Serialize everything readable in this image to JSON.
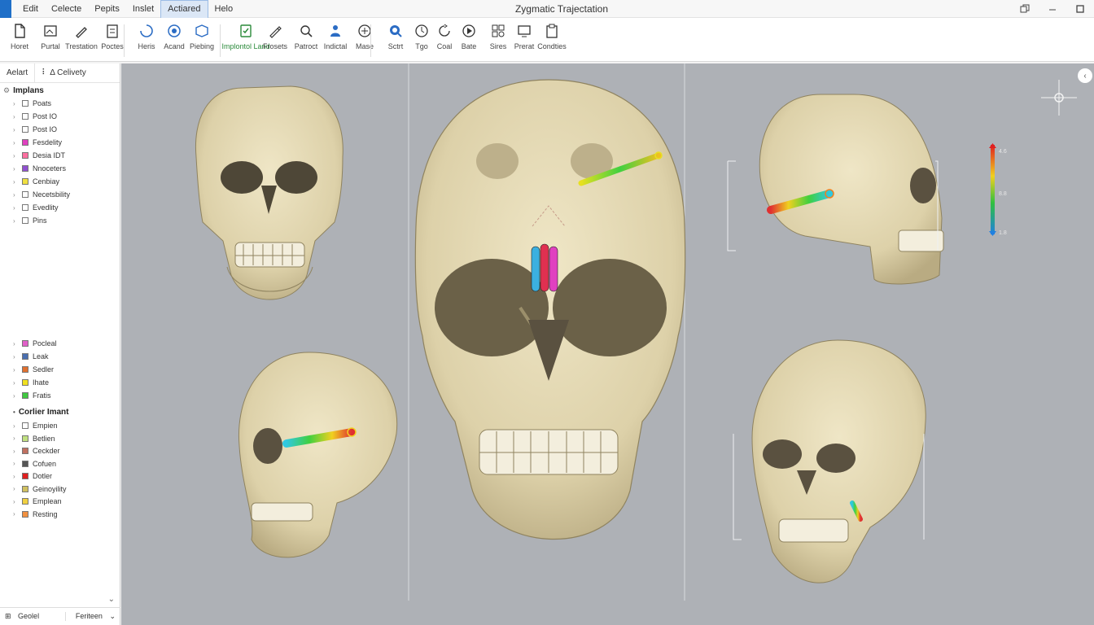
{
  "window": {
    "title": "Zygmatic Trajectation"
  },
  "menu": {
    "items": [
      "Edit",
      "Celecte",
      "Pepits",
      "Inslet",
      "Actiared",
      "Helo"
    ],
    "active_index": 4
  },
  "toolbar": {
    "tools": [
      {
        "label": "Horet",
        "icon": "file-icon"
      },
      {
        "label": "Purtal",
        "icon": "image-icon"
      },
      {
        "label": "Trestation",
        "icon": "pen-icon"
      },
      {
        "label": "Poctes",
        "icon": "document-icon"
      },
      {
        "label": "Heris",
        "icon": "circle-arc-icon"
      },
      {
        "label": "Acand",
        "icon": "target-icon"
      },
      {
        "label": "Piebing",
        "icon": "box-icon"
      },
      {
        "label": "Implontol Land",
        "icon": "implant-icon"
      },
      {
        "label": "Frosets",
        "icon": "pencil-icon"
      },
      {
        "label": "Patroct",
        "icon": "magnifier-icon"
      },
      {
        "label": "Indictal",
        "icon": "person-icon"
      },
      {
        "label": "Mase",
        "icon": "plus-circle-icon"
      },
      {
        "label": "Sctrt",
        "icon": "search-icon"
      },
      {
        "label": "Tgo",
        "icon": "clock-icon"
      },
      {
        "label": "Coal",
        "icon": "refresh-icon"
      },
      {
        "label": "Bate",
        "icon": "play-circle-icon"
      },
      {
        "label": "Sires",
        "icon": "gear-grid-icon"
      },
      {
        "label": "Prerat",
        "icon": "screen-icon"
      },
      {
        "label": "Condties",
        "icon": "clipboard-icon"
      }
    ]
  },
  "left_panel": {
    "tabs": [
      "Aelart",
      "Celivety"
    ],
    "root_label": "Implans",
    "tree_items": [
      {
        "label": "Poats",
        "swatch": "#ffffff"
      },
      {
        "label": "Post IO",
        "swatch": "#ffffff"
      },
      {
        "label": "Post IO",
        "swatch": "#ffffff"
      },
      {
        "label": "Fesdelity",
        "swatch": "#e040c0"
      },
      {
        "label": "Desia IDT",
        "swatch": "#ff6fa0"
      },
      {
        "label": "Nnoceters",
        "swatch": "#9050d0"
      },
      {
        "label": "Cenbiay",
        "swatch": "#f0e040"
      },
      {
        "label": "Necetsbility",
        "swatch": "#ffffff"
      },
      {
        "label": "Evedlity",
        "swatch": "#ffffff"
      },
      {
        "label": "Pins",
        "swatch": "#ffffff"
      }
    ],
    "material_items": [
      {
        "label": "Pocleal",
        "swatch": "#e060c8"
      },
      {
        "label": "Leak",
        "swatch": "#4a6fb0"
      },
      {
        "label": "Sedler",
        "swatch": "#e07030"
      },
      {
        "label": "Ihate",
        "swatch": "#f0e020"
      },
      {
        "label": "Fratis",
        "swatch": "#40c840"
      }
    ],
    "group_label": "Corlier Imant",
    "group_items": [
      {
        "label": "Empien",
        "swatch": "#ffffff"
      },
      {
        "label": "Betlien",
        "swatch": "#c0e080"
      },
      {
        "label": "Ceckder",
        "swatch": "#c07060"
      },
      {
        "label": "Cofuen",
        "swatch": "#555555"
      },
      {
        "label": "Dotler",
        "swatch": "#e02020"
      },
      {
        "label": "Geinoyility",
        "swatch": "#d0c060"
      },
      {
        "label": "Emplean",
        "swatch": "#f0d040"
      },
      {
        "label": "Resting",
        "swatch": "#f09040"
      }
    ],
    "footer": {
      "left": "Geolel",
      "right": "Feriteen"
    }
  },
  "viewport": {
    "legend_ticks": [
      "4.6",
      "8.8",
      "1.8"
    ],
    "legend_colors": [
      "#e02020",
      "#f0d020",
      "#30c040",
      "#2080e0"
    ],
    "bone_color": "#e3d8b4"
  }
}
